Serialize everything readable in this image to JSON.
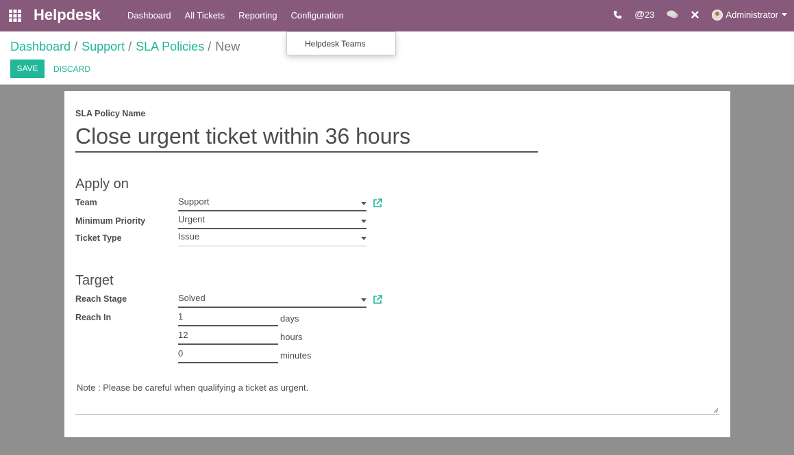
{
  "navbar": {
    "brand": "Helpdesk",
    "menu": [
      "Dashboard",
      "All Tickets",
      "Reporting",
      "Configuration"
    ],
    "messages_count": "23",
    "user": "Administrator",
    "bg_color": "#875a7b"
  },
  "dropdown": {
    "item": "Helpdesk Teams"
  },
  "breadcrumb": {
    "items": [
      "Dashboard",
      "Support",
      "SLA Policies"
    ],
    "current": "New",
    "separator": "/"
  },
  "buttons": {
    "save": "SAVE",
    "discard": "DISCARD"
  },
  "form": {
    "name_label": "SLA Policy Name",
    "name_value": "Close urgent ticket within 36 hours",
    "apply_on": {
      "title": "Apply on",
      "team_label": "Team",
      "team_value": "Support",
      "priority_label": "Minimum Priority",
      "priority_value": "Urgent",
      "type_label": "Ticket Type",
      "type_value": "Issue"
    },
    "target": {
      "title": "Target",
      "stage_label": "Reach Stage",
      "stage_value": "Solved",
      "reach_in_label": "Reach In",
      "days_value": "1",
      "days_unit": "days",
      "hours_value": "12",
      "hours_unit": "hours",
      "minutes_value": "0",
      "minutes_unit": "minutes"
    },
    "note": "Note : Please be careful when qualifying a ticket as urgent."
  },
  "accent_color": "#21b799"
}
